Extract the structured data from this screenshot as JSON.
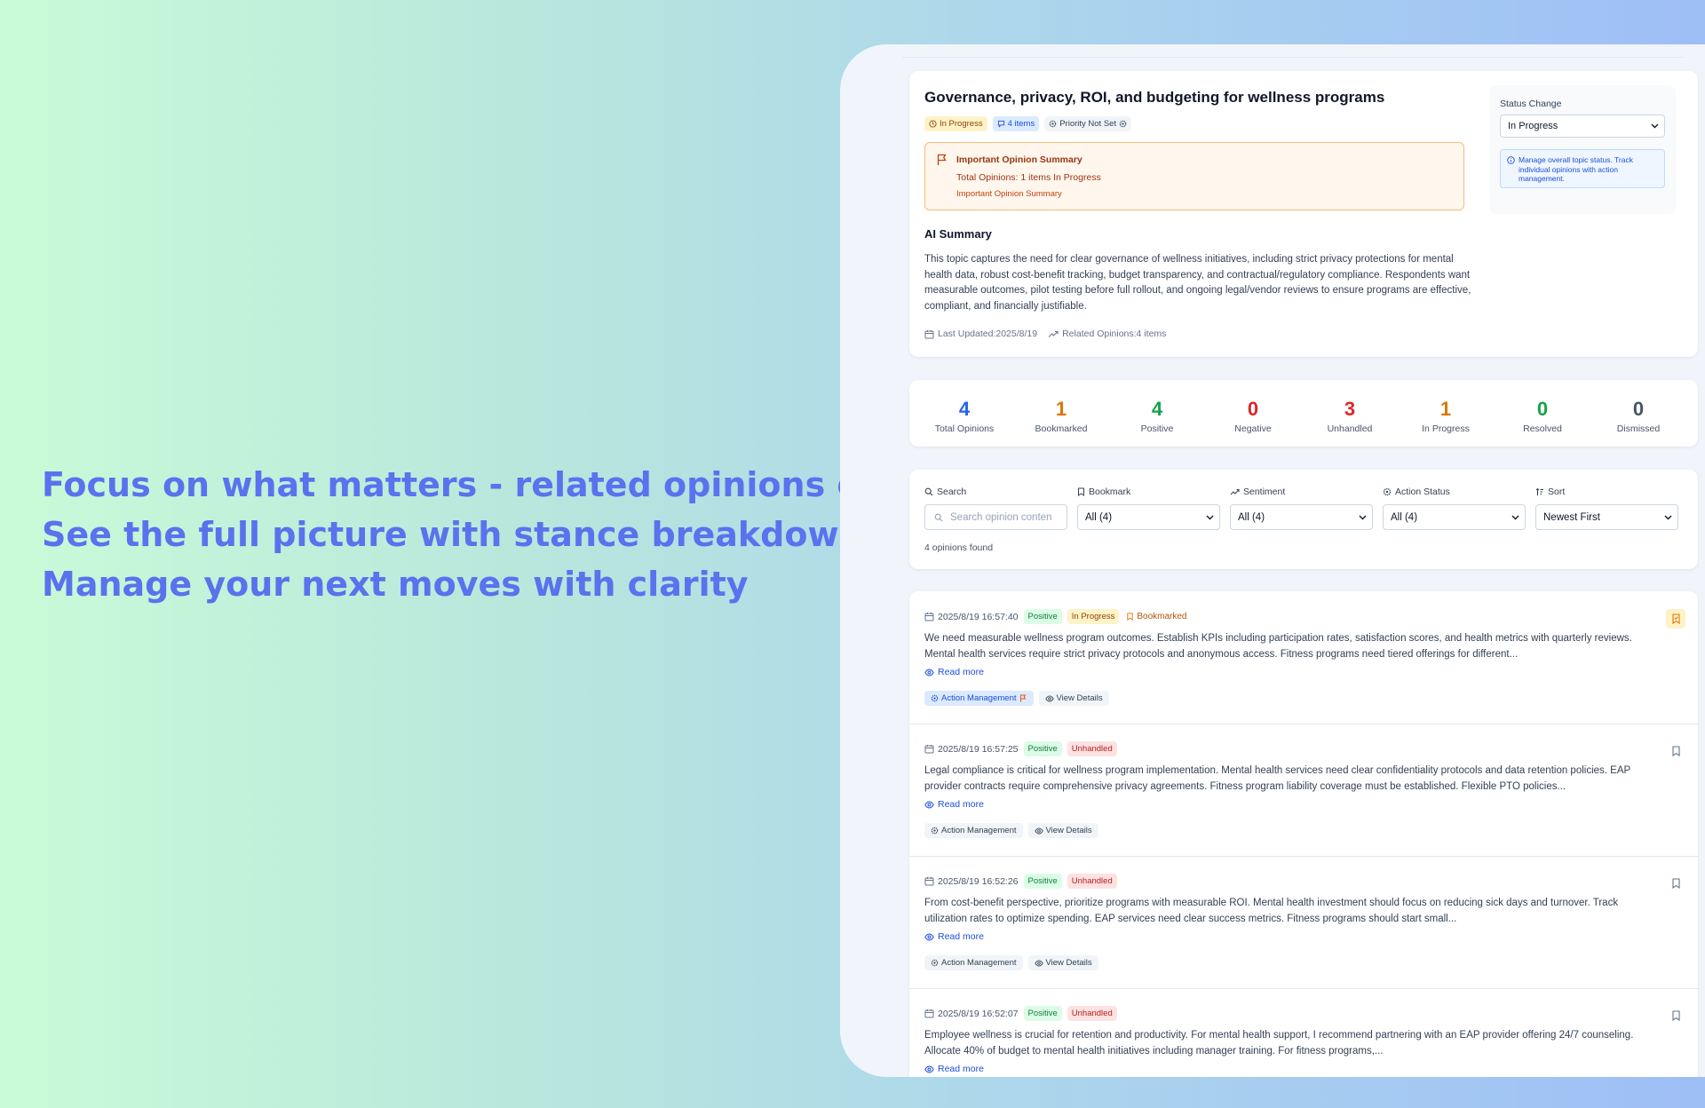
{
  "hero": {
    "line1": "Focus on what matters - related opinions only",
    "line2": "See the full picture with stance breakdown",
    "line3": "Manage your next moves with clarity"
  },
  "topic": {
    "title": "Governance, privacy, ROI, and budgeting for wellness programs",
    "chips": {
      "status": "In Progress",
      "items": "4 items",
      "priority": "Priority Not Set"
    },
    "alert": {
      "title": "Important Opinion Summary",
      "total": "Total Opinions: 1 items In Progress",
      "sub": "Important Opinion Summary"
    },
    "ai_title": "AI Summary",
    "ai_text": "This topic captures the need for clear governance of wellness initiatives, including strict privacy protections for mental health data, robust cost-benefit tracking, budget transparency, and contractual/regulatory compliance. Respondents want measurable outcomes, pilot testing before full rollout, and ongoing legal/vendor reviews to ensure programs are effective, compliant, and financially justifiable.",
    "last_updated": "Last Updated:2025/8/19",
    "related": "Related Opinions:4 items",
    "status_change": {
      "label": "Status Change",
      "value": "In Progress",
      "note": "Manage overall topic status. Track individual opinions with action management."
    }
  },
  "stats": [
    {
      "value": "4",
      "label": "Total Opinions",
      "color": "#2563eb"
    },
    {
      "value": "1",
      "label": "Bookmarked",
      "color": "#d97706"
    },
    {
      "value": "4",
      "label": "Positive",
      "color": "#16a34a"
    },
    {
      "value": "0",
      "label": "Negative",
      "color": "#dc2626"
    },
    {
      "value": "3",
      "label": "Unhandled",
      "color": "#dc2626"
    },
    {
      "value": "1",
      "label": "In Progress",
      "color": "#d97706"
    },
    {
      "value": "0",
      "label": "Resolved",
      "color": "#16a34a"
    },
    {
      "value": "0",
      "label": "Dismissed",
      "color": "#475569"
    }
  ],
  "filters": {
    "search": {
      "label": "Search",
      "placeholder": "Search opinion conten"
    },
    "bookmark": {
      "label": "Bookmark",
      "value": "All (4)"
    },
    "sentiment": {
      "label": "Sentiment",
      "value": "All (4)"
    },
    "action": {
      "label": "Action Status",
      "value": "All (4)"
    },
    "sort": {
      "label": "Sort",
      "value": "Newest First"
    },
    "found": "4 opinions found"
  },
  "opinions": [
    {
      "date": "2025/8/19 16:57:40",
      "sentiment": "Positive",
      "status": "In Progress",
      "bookmark": "Bookmarked",
      "text": "We need measurable wellness program outcomes. Establish KPIs including participation rates, satisfaction scores, and health metrics with quarterly reviews. Mental health services require strict privacy protocols and anonymous access. Fitness programs need tiered offerings for different...",
      "read_more": "Read more",
      "action": "Action Management",
      "details": "View Details"
    },
    {
      "date": "2025/8/19 16:57:25",
      "sentiment": "Positive",
      "status": "Unhandled",
      "text": "Legal compliance is critical for wellness program implementation. Mental health services need clear confidentiality protocols and data retention policies. EAP provider contracts require comprehensive privacy agreements. Fitness program liability coverage must be established. Flexible PTO policies...",
      "read_more": "Read more",
      "action": "Action Management",
      "details": "View Details"
    },
    {
      "date": "2025/8/19 16:52:26",
      "sentiment": "Positive",
      "status": "Unhandled",
      "text": "From cost-benefit perspective, prioritize programs with measurable ROI. Mental health investment should focus on reducing sick days and turnover. Track utilization rates to optimize spending. EAP services need clear success metrics. Fitness programs should start small...",
      "read_more": "Read more",
      "action": "Action Management",
      "details": "View Details"
    },
    {
      "date": "2025/8/19 16:52:07",
      "sentiment": "Positive",
      "status": "Unhandled",
      "text": "Employee wellness is crucial for retention and productivity. For mental health support, I recommend partnering with an EAP provider offering 24/7 counseling. Allocate 40% of budget to mental health initiatives including manager training. For fitness programs,...",
      "read_more": "Read more",
      "action": "Action Management",
      "details": "View Details"
    }
  ]
}
